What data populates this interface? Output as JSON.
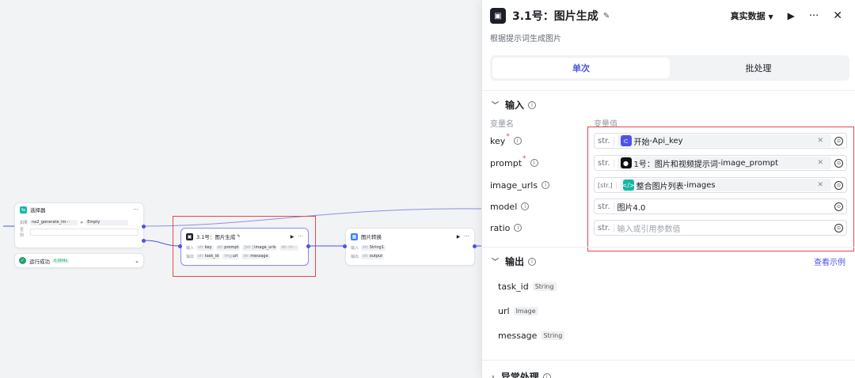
{
  "canvas": {
    "selector_node": {
      "title": "选择器",
      "if_label": "如果",
      "field": "na2_generate_im···",
      "op": "≠",
      "value": "Empty",
      "else_label": "否则",
      "status": "运行成功",
      "time": "0.004s"
    },
    "gen_node": {
      "title": "3.1号：图片生成",
      "in_label": "输入",
      "out_label": "输出",
      "inputs": [
        "key",
        "prompt",
        "image_urls",
        "im···"
      ],
      "outputs": [
        "task_id",
        "url",
        "message"
      ]
    },
    "conv_node": {
      "title": "图片转换",
      "in_label": "输入",
      "out_label": "输出",
      "input": "String1",
      "output": "output"
    }
  },
  "panel": {
    "title": "3.1号：图片生成",
    "description": "根据提示词生成图片",
    "data_mode": "真实数据",
    "tabs": [
      "单次",
      "批处理"
    ],
    "input_section": "输入",
    "col_name": "变量名",
    "col_value": "变量值",
    "inputs": [
      {
        "name": "key",
        "required": "*",
        "type": "str.",
        "source": "开始",
        "var": "Api_key",
        "sep": " - ",
        "icon_color": "#4d53e8"
      },
      {
        "name": "prompt",
        "required": "*",
        "type": "str.",
        "source": "1号：图片和视频提示词",
        "var": "image_prompt",
        "sep": " - ",
        "icon_color": "#111111"
      },
      {
        "name": "image_urls",
        "required": "",
        "type": "[str.]",
        "source": "整合图片列表",
        "var": "images",
        "sep": " - ",
        "icon_color": "#14b8a6"
      },
      {
        "name": "model",
        "required": "",
        "type": "str.",
        "value": "图片4.0"
      },
      {
        "name": "ratio",
        "required": "",
        "type": "str.",
        "placeholder": "输入或引用参数值"
      }
    ],
    "output_section": "输出",
    "view_example": "查看示例",
    "outputs": [
      {
        "name": "task_id",
        "type": "String"
      },
      {
        "name": "url",
        "type": "Image"
      },
      {
        "name": "message",
        "type": "String"
      }
    ],
    "exception_section": "异常处理"
  }
}
